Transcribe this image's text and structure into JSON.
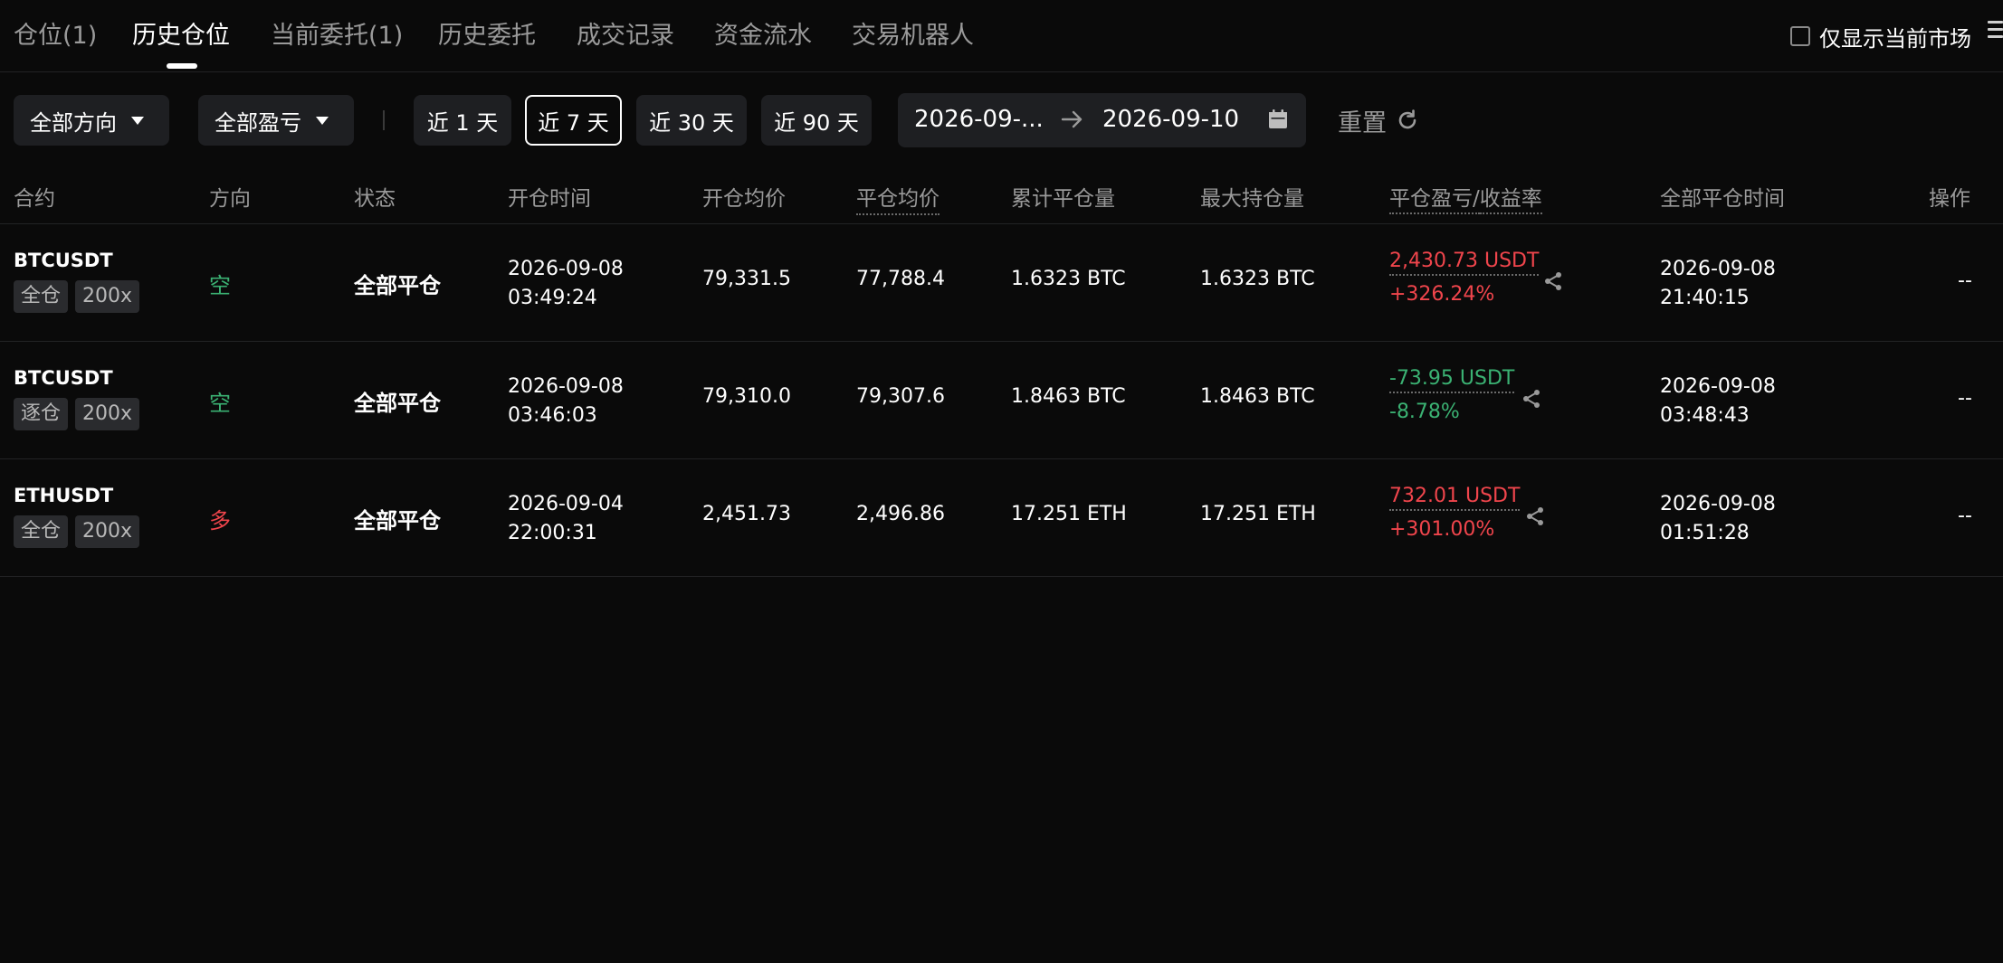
{
  "tabs": [
    {
      "label": "仓位(1)"
    },
    {
      "label": "历史仓位"
    },
    {
      "label": "当前委托(1)"
    },
    {
      "label": "历史委托"
    },
    {
      "label": "成交记录"
    },
    {
      "label": "资金流水"
    },
    {
      "label": "交易机器人"
    }
  ],
  "active_tab": "历史仓位",
  "only_current_market_label": "仅显示当前市场",
  "filters": {
    "direction": "全部方向",
    "pnl": "全部盈亏",
    "quick_ranges": [
      "近 1 天",
      "近 7 天",
      "近 30 天",
      "近 90 天"
    ],
    "selected_range": "近 7 天",
    "date_start": "2026-09-...",
    "date_end": "2026-09-10",
    "reset_label": "重置"
  },
  "columns": {
    "contract": "合约",
    "direction": "方向",
    "status": "状态",
    "open_time": "开仓时间",
    "open_avg": "开仓均价",
    "close_avg": "平仓均价",
    "closed_qty": "累计平仓量",
    "max_pos": "最大持仓量",
    "pnl_prefix": "平仓盈亏/",
    "pnl_suffix": "收益率",
    "close_time": "全部平仓时间",
    "ops": "操作"
  },
  "rows": [
    {
      "symbol": "BTCUSDT",
      "margin": "全仓",
      "leverage": "200x",
      "direction": "空",
      "status": "全部平仓",
      "open_date": "2026-09-08",
      "open_time": "03:49:24",
      "open_avg": "79,331.5",
      "close_avg": "77,788.4",
      "closed_qty": "1.6323 BTC",
      "max_pos": "1.6323 BTC",
      "pnl": "2,430.73 USDT",
      "roi": "+326.24%",
      "close_date": "2026-09-08",
      "close_time": "21:40:15",
      "ops": "--"
    },
    {
      "symbol": "BTCUSDT",
      "margin": "逐仓",
      "leverage": "200x",
      "direction": "空",
      "status": "全部平仓",
      "open_date": "2026-09-08",
      "open_time": "03:46:03",
      "open_avg": "79,310.0",
      "close_avg": "79,307.6",
      "closed_qty": "1.8463 BTC",
      "max_pos": "1.8463 BTC",
      "pnl": "-73.95 USDT",
      "roi": "-8.78%",
      "close_date": "2026-09-08",
      "close_time": "03:48:43",
      "ops": "--"
    },
    {
      "symbol": "ETHUSDT",
      "margin": "全仓",
      "leverage": "200x",
      "direction": "多",
      "status": "全部平仓",
      "open_date": "2026-09-04",
      "open_time": "22:00:31",
      "open_avg": "2,451.73",
      "close_avg": "2,496.86",
      "closed_qty": "17.251 ETH",
      "max_pos": "17.251 ETH",
      "pnl": "732.01 USDT",
      "roi": "+301.00%",
      "close_date": "2026-09-08",
      "close_time": "01:51:28",
      "ops": "--"
    }
  ],
  "colors": {
    "background": "#0a0a0a",
    "profit": "#f0454c",
    "loss": "#3bb273",
    "short": "#3bb273",
    "long": "#f0454c",
    "muted": "#9a9a9a"
  }
}
